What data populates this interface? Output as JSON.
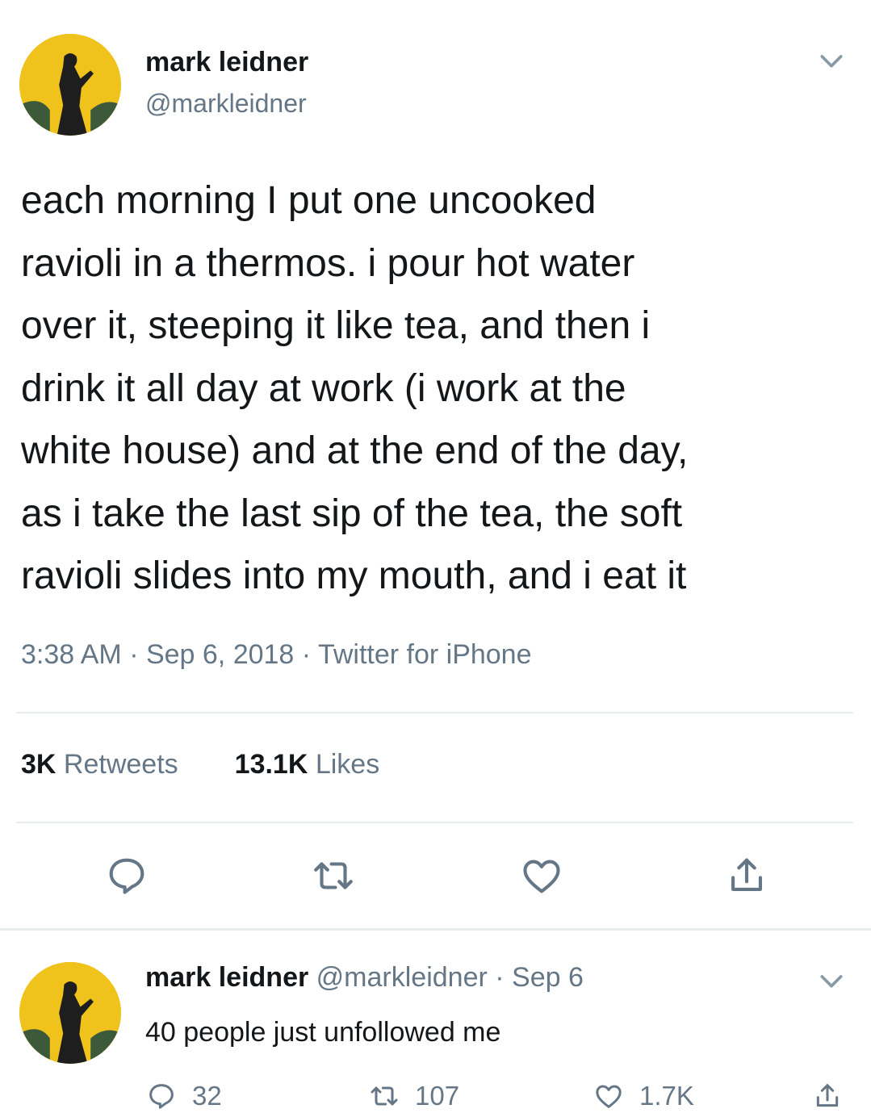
{
  "tweet": {
    "author_name": "mark leidner",
    "author_handle": "@markleidner",
    "text_lines": [
      "each morning I put one uncooked",
      "ravioli in a thermos. i pour hot water",
      "over it, steeping it like tea, and then i",
      "drink it all day at work (i work at the",
      "white house) and at the end of the day,",
      "as i take the last sip of the tea, the soft",
      "ravioli slides into my mouth, and i eat it"
    ],
    "meta": "3:38 AM · Sep 6, 2018 · Twitter for iPhone",
    "retweets_count": "3K",
    "retweets_label": "Retweets",
    "likes_count": "13.1K",
    "likes_label": "Likes"
  },
  "reply": {
    "author_name": "mark leidner",
    "author_handle_date": "@markleidner · Sep 6",
    "text": "40 people just unfollowed me",
    "reply_count": "32",
    "retweet_count": "107",
    "like_count": "1.7K"
  },
  "colors": {
    "text": "#14171a",
    "secondary": "#657786",
    "divider": "#e6ecf0",
    "avatar_bg": "#f0c419"
  }
}
